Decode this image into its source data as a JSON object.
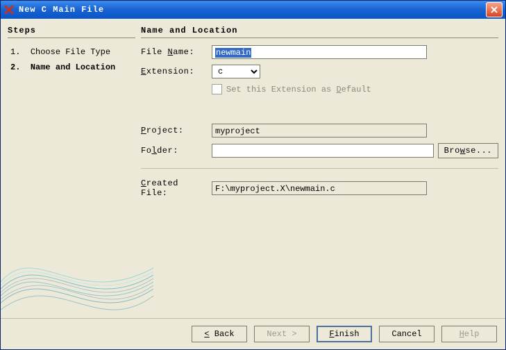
{
  "title": "New C Main File",
  "steps": {
    "heading": "Steps",
    "items": [
      {
        "num": "1.",
        "label": "Choose File Type",
        "current": false
      },
      {
        "num": "2.",
        "label": "Name and Location",
        "current": true
      }
    ]
  },
  "form": {
    "heading": "Name and Location",
    "file_name_label_pre": "File ",
    "file_name_label_u": "N",
    "file_name_label_post": "ame:",
    "file_name_value": "newmain",
    "extension_label_u": "E",
    "extension_label_post": "xtension:",
    "extension_value": "c",
    "set_default_label_pre": "Set this Extension as ",
    "set_default_label_u": "D",
    "set_default_label_post": "efault",
    "project_label_u": "P",
    "project_label_post": "roject:",
    "project_value": "myproject",
    "folder_label_pre": "Fo",
    "folder_label_u": "l",
    "folder_label_post": "der:",
    "folder_value": "",
    "browse_label_pre": "Bro",
    "browse_label_u": "w",
    "browse_label_post": "se...",
    "created_label_u": "C",
    "created_label_post": "reated File:",
    "created_value": "F:\\myproject.X\\newmain.c"
  },
  "buttons": {
    "back": "< Back",
    "next": "Next >",
    "finish": "Finish",
    "cancel": "Cancel",
    "help": "Help"
  }
}
